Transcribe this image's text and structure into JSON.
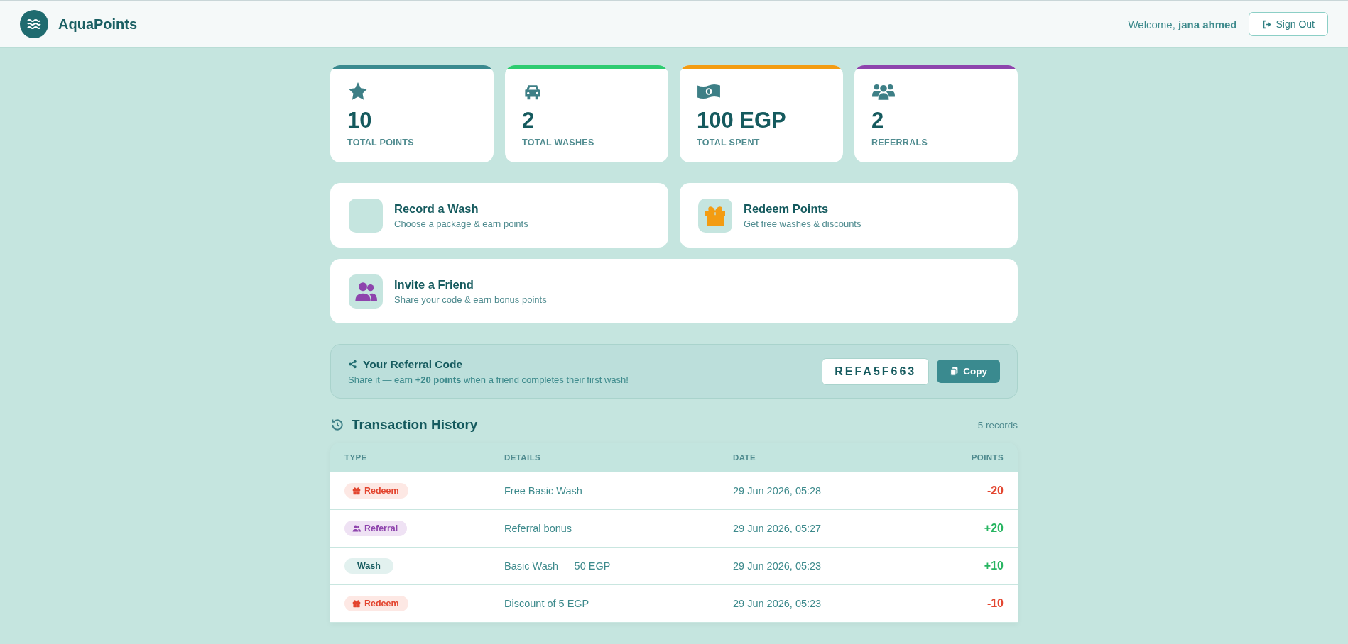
{
  "header": {
    "brand": "AquaPoints",
    "welcome": "Welcome, **jana ahmed**",
    "sign_out": "Sign Out"
  },
  "stats": [
    {
      "kind": "points",
      "value": "10",
      "label": "TOTAL POINTS",
      "color": "#3a8a8f"
    },
    {
      "kind": "washes",
      "value": "2",
      "label": "TOTAL WASHES",
      "color": "#2ecc71"
    },
    {
      "kind": "spent",
      "value": "100 EGP",
      "label": "TOTAL SPENT",
      "color": "#f39c12"
    },
    {
      "kind": "referrals",
      "value": "2",
      "label": "REFERRALS",
      "color": "#8e44ad"
    }
  ],
  "actions": [
    {
      "kind": "wash",
      "title": "Record a Wash",
      "subtitle": "Choose a package & earn points"
    },
    {
      "kind": "redeem",
      "title": "Redeem Points",
      "subtitle": "Get free washes & discounts"
    },
    {
      "kind": "invite",
      "title": "Invite a Friend",
      "subtitle": "Share your code & earn bonus points"
    }
  ],
  "referral": {
    "title": "Your Referral Code",
    "text": "Share it — earn **+20 points** when a friend completes their first wash!",
    "code": "REFA5F663",
    "copy": "Copy"
  },
  "history": {
    "title": "Transaction History",
    "count": "5 records",
    "columns": [
      "TYPE",
      "DETAILS",
      "DATE",
      "POINTS"
    ],
    "rows": [
      {
        "kind": "redeem",
        "type": "Redeem",
        "details": "Free Basic Wash",
        "date": "29 Jun 2026, 05:28",
        "points": "-20"
      },
      {
        "kind": "referral",
        "type": "Referral",
        "details": "Referral bonus",
        "date": "29 Jun 2026, 05:27",
        "points": "+20"
      },
      {
        "kind": "wash",
        "type": "Wash",
        "details": "Basic Wash — 50 EGP",
        "date": "29 Jun 2026, 05:23",
        "points": "+10"
      },
      {
        "kind": "redeem",
        "type": "Redeem",
        "details": "Discount of 5 EGP",
        "date": "29 Jun 2026, 05:23",
        "points": "-10"
      }
    ]
  }
}
